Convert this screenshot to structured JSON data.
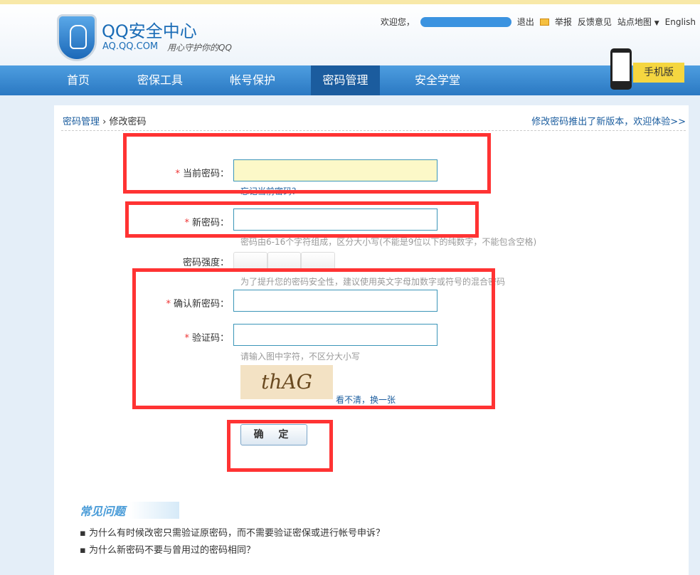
{
  "header": {
    "title": "QQ安全中心",
    "domain": "AQ.QQ.COM",
    "slogan": "用心守护你的QQ",
    "welcome": "欢迎您，",
    "logout": "退出",
    "report": "举报",
    "feedback": "反馈意见",
    "sitemap": "站点地图",
    "english": "English",
    "mobile": "手机版"
  },
  "nav": [
    {
      "label": "首页"
    },
    {
      "label": "密保工具"
    },
    {
      "label": "帐号保护"
    },
    {
      "label": "密码管理",
      "active": true
    },
    {
      "label": "安全学堂"
    }
  ],
  "breadcrumb": {
    "parent": "密码管理",
    "sep": "›",
    "current": "修改密码"
  },
  "promo": "修改密码推出了新版本，欢迎体验>>",
  "form": {
    "current_label": "当前密码：",
    "forgot": "忘记当前密码？",
    "new_label": "新密码：",
    "new_hint": "密码由6-16个字符组成，区分大小写(不能是9位以下的纯数字，不能包含空格)",
    "strength_label": "密码强度：",
    "strength_hint": "为了提升您的密码安全性，建议使用英文字母加数字或符号的混合密码",
    "confirm_label": "确认新密码：",
    "captcha_label": "验证码：",
    "captcha_hint": "请输入图中字符，不区分大小写",
    "captcha_text": "thAG",
    "refresh": "看不清，换一张",
    "required": "*",
    "submit": "确 定"
  },
  "faq": {
    "title": "常见问题",
    "items": [
      "为什么有时候改密只需验证原密码，而不需要验证密保或进行帐号申诉？",
      "为什么新密码不要与曾用过的密码相同？"
    ]
  },
  "colors": {
    "nav": "#2a78c2",
    "highlight": "#ff3333"
  }
}
